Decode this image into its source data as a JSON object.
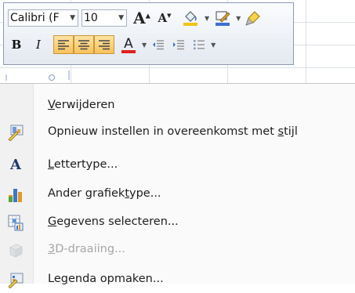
{
  "mini_toolbar": {
    "font_name": "Calibri (F",
    "font_size": "10",
    "grow_font_glyph": "A",
    "shrink_font_glyph": "A",
    "bold_glyph": "B",
    "italic_glyph": "I",
    "font_color_glyph": "A",
    "colors": {
      "fill": "#f0c419",
      "outline": "#3d6fd1",
      "font_color_bar": "#e02020",
      "highlight": "#f7c25c"
    },
    "icons": [
      "grow-font-icon",
      "shrink-font-icon",
      "fill-color-icon",
      "outline-color-icon",
      "format-painter-icon",
      "align-left-icon",
      "align-center-icon",
      "align-right-icon",
      "font-color-icon",
      "decrease-indent-icon",
      "increase-indent-icon",
      "bullets-icon"
    ]
  },
  "context_menu": {
    "items": [
      {
        "key": "V",
        "rest": "erwijderen",
        "pre": "",
        "icon": "none",
        "disabled": false
      },
      {
        "pre": "Opnieuw instellen in overeenkomst met ",
        "key": "s",
        "rest": "tijl",
        "icon": "reset-style-icon",
        "disabled": false
      },
      {
        "pre": "",
        "key": "L",
        "rest": "ettertype...",
        "icon": "font-icon",
        "disabled": false
      },
      {
        "pre": "Ander grafiek",
        "key": "t",
        "rest": "ype...",
        "icon": "chart-type-icon",
        "disabled": false
      },
      {
        "pre": "",
        "key": "G",
        "rest": "egevens selecteren...",
        "icon": "select-data-icon",
        "disabled": false
      },
      {
        "pre": "",
        "key": "3",
        "rest": "D-draaiing...",
        "icon": "3d-rotation-icon",
        "disabled": true
      },
      {
        "pre": "Le",
        "key": "g",
        "rest": "enda opmaken...",
        "icon": "format-legend-icon",
        "disabled": false
      }
    ]
  }
}
